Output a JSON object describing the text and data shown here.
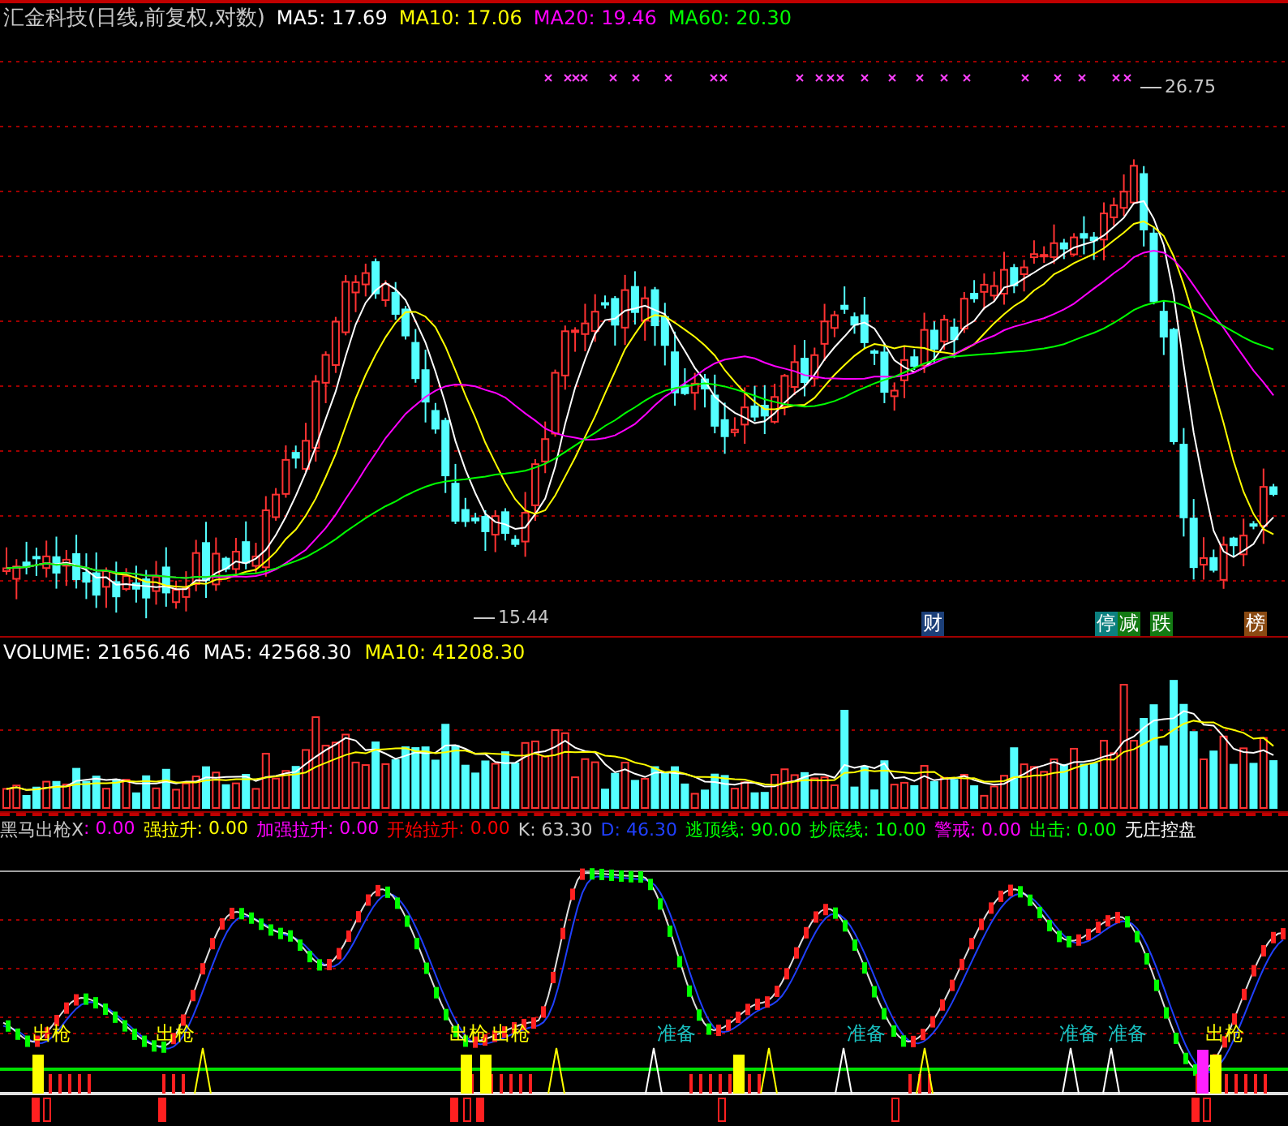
{
  "main_panel": {
    "title": "汇金科技(日线,前复权,对数)",
    "legend": [
      {
        "label": "MA5: 17.69",
        "color": "#ffffff"
      },
      {
        "label": "MA10: 17.06",
        "color": "#ffff00"
      },
      {
        "label": "MA20: 19.46",
        "color": "#ff00ff"
      },
      {
        "label": "MA60: 20.30",
        "color": "#00ff00"
      }
    ],
    "price_labels": [
      {
        "text": "26.75",
        "kind": "high"
      },
      {
        "text": "15.44",
        "kind": "low"
      }
    ],
    "signal_tags": [
      {
        "text": "财",
        "color": "#1c3f78"
      },
      {
        "text": "停",
        "color": "#0b8080"
      },
      {
        "text": "减",
        "color": "#137a13"
      },
      {
        "text": "跌",
        "color": "#137a13"
      },
      {
        "text": "榜",
        "color": "#8a4a12"
      }
    ]
  },
  "volume_panel": {
    "legend": [
      {
        "label": "VOLUME: 21656.46",
        "color": "#ffffff"
      },
      {
        "label": "MA5: 42568.30",
        "color": "#ffffff"
      },
      {
        "label": "MA10: 41208.30",
        "color": "#ffff00"
      }
    ]
  },
  "indicator_panel": {
    "legend": [
      {
        "kind": "label",
        "text": "黑马出枪X",
        "color": "#c8c8c8"
      },
      {
        "kind": "value",
        "text": ": 0.00",
        "color": "#ff00ff"
      },
      {
        "kind": "label",
        "text": "强拉升",
        "color": "#ffff00"
      },
      {
        "kind": "value",
        "text": ": 0.00",
        "color": "#ffff00"
      },
      {
        "kind": "label",
        "text": "加强拉升",
        "color": "#ff00ff"
      },
      {
        "kind": "value",
        "text": ": 0.00",
        "color": "#ff00ff"
      },
      {
        "kind": "label",
        "text": "开始拉升",
        "color": "#ff0000"
      },
      {
        "kind": "value",
        "text": ": 0.00",
        "color": "#ff0000"
      },
      {
        "kind": "label",
        "text": "K: 63.30",
        "color": "#c8c8c8"
      },
      {
        "kind": "label",
        "text": "D: 46.30",
        "color": "#2040ff"
      },
      {
        "kind": "label",
        "text": "逃顶线: 90.00",
        "color": "#00ff00"
      },
      {
        "kind": "label",
        "text": "抄底线: 10.00",
        "color": "#00ff00"
      },
      {
        "kind": "label",
        "text": "警戒: 0.00",
        "color": "#ff00ff"
      },
      {
        "kind": "label",
        "text": "出击: 0.00",
        "color": "#00ff00"
      },
      {
        "kind": "label",
        "text": "无庄控盘",
        "color": "#ffffff"
      }
    ],
    "markers": [
      {
        "text": "出枪",
        "color": "#ffff00"
      },
      {
        "text": "出枪",
        "color": "#ffff00"
      },
      {
        "text": "出枪",
        "color": "#ffff00"
      },
      {
        "text": "出枪",
        "color": "#ffff00"
      },
      {
        "text": "准备",
        "color": "#19c0c0"
      },
      {
        "text": "准备",
        "color": "#19c0c0"
      },
      {
        "text": "准备",
        "color": "#19c0c0"
      },
      {
        "text": "准备",
        "color": "#19c0c0"
      },
      {
        "text": "出枪",
        "color": "#ffff00"
      }
    ]
  }
}
